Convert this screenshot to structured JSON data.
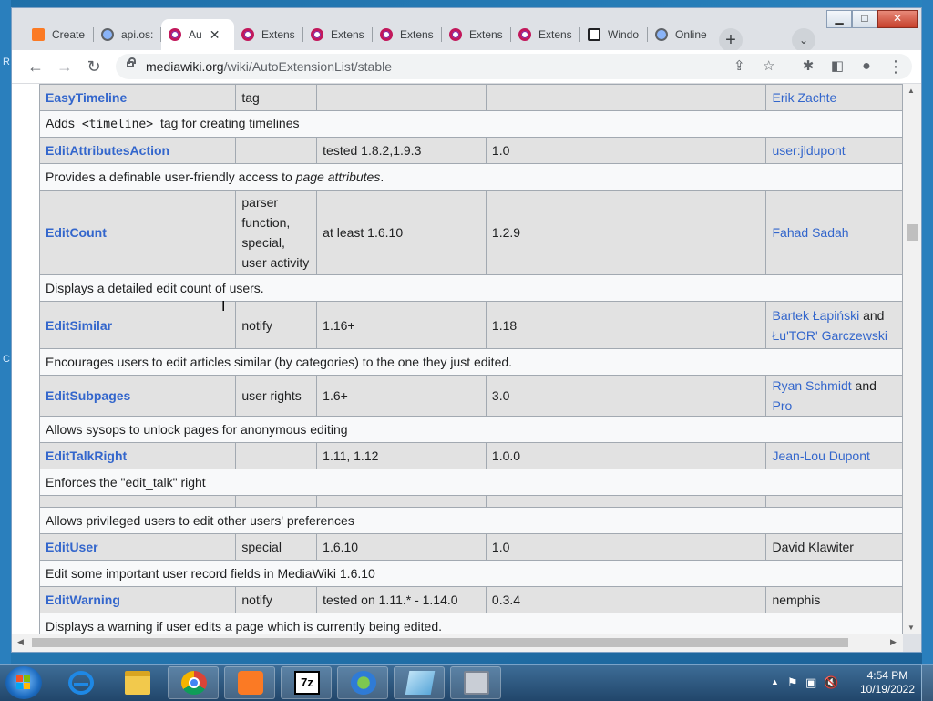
{
  "browser": {
    "tabs": [
      {
        "title": "Create",
        "icon": "xampp-icon",
        "active": false
      },
      {
        "title": "api.os:",
        "icon": "globe-icon",
        "active": false
      },
      {
        "title": "Au",
        "icon": "ring-icon",
        "active": true
      },
      {
        "title": "Extens",
        "icon": "ring-icon",
        "active": false
      },
      {
        "title": "Extens",
        "icon": "ring-icon",
        "active": false
      },
      {
        "title": "Extens",
        "icon": "ring-icon",
        "active": false
      },
      {
        "title": "Extens",
        "icon": "ring-icon",
        "active": false
      },
      {
        "title": "Extens",
        "icon": "ring-icon",
        "active": false
      },
      {
        "title": "Windo",
        "icon": "wiki-icon",
        "active": false
      },
      {
        "title": "Online",
        "icon": "globe-icon",
        "active": false
      }
    ],
    "tab_close": "✕",
    "new_tab": "+",
    "tab_list": "⌄",
    "window_controls": {
      "minimize": "▁",
      "maximize": "□",
      "close": "✕"
    },
    "url_host": "mediawiki.org",
    "url_path": "/wiki/AutoExtensionList/stable",
    "nav": {
      "back": "←",
      "forward": "→",
      "reload": "↻"
    },
    "toolbar_icons": {
      "share": "⇪",
      "star": "☆",
      "extensions": "✱",
      "sidepanel": "◧",
      "profile": "●",
      "menu": "⋮"
    }
  },
  "table": {
    "rows": [
      {
        "kind": "main",
        "name": "EasyTimeline",
        "type": "tag",
        "mw": "",
        "version": "",
        "author": [
          {
            "text": "Erik Zachte",
            "link": true
          }
        ]
      },
      {
        "kind": "desc",
        "pre": "Adds ",
        "code": "<timeline>",
        "post": " tag for creating timelines"
      },
      {
        "kind": "main",
        "name": "EditAttributesAction",
        "type": "",
        "mw": "tested 1.8.2,1.9.3",
        "version": "1.0",
        "author": [
          {
            "text": "user:jldupont",
            "link": true
          }
        ]
      },
      {
        "kind": "desc",
        "pre": "Provides a definable user-friendly access to ",
        "em": "page attributes",
        "post": "."
      },
      {
        "kind": "main",
        "name": "EditCount",
        "type": "parser function, special, user activity",
        "mw": "at least 1.6.10",
        "version": "1.2.9",
        "author": [
          {
            "text": "Fahad Sadah",
            "link": true
          }
        ]
      },
      {
        "kind": "desc",
        "pre": "Displays a detailed edit count of users."
      },
      {
        "kind": "main",
        "name": "EditSimilar",
        "type": "notify",
        "mw": "1.16+",
        "version": "1.18",
        "author": [
          {
            "text": "Bartek Łapiński",
            "link": true
          },
          {
            "text": " and ",
            "link": false
          },
          {
            "text": "Łu",
            "link": true
          },
          {
            "text": "'TOR' Garczewski",
            "link": true
          }
        ]
      },
      {
        "kind": "desc",
        "pre": "Encourages users to edit articles similar (by categories) to the one they just edited."
      },
      {
        "kind": "main",
        "name": "EditSubpages",
        "type": "user rights",
        "mw": "1.6+",
        "version": "3.0",
        "author": [
          {
            "text": "Ryan Schmidt",
            "link": true
          },
          {
            "text": " and ",
            "link": false
          },
          {
            "text": "Pro",
            "link": true
          }
        ]
      },
      {
        "kind": "desc",
        "pre": "Allows sysops to unlock pages for anonymous editing"
      },
      {
        "kind": "main",
        "name": "EditTalkRight",
        "type": "",
        "mw": "1.11, 1.12",
        "version": "1.0.0",
        "author": [
          {
            "text": "Jean-Lou Dupont",
            "link": true
          }
        ]
      },
      {
        "kind": "desc",
        "pre": "Enforces the \"edit_talk\" right"
      },
      {
        "kind": "main",
        "name": "",
        "type": "",
        "mw": "",
        "version": "",
        "author": []
      },
      {
        "kind": "desc",
        "pre": "Allows privileged users to edit other users' preferences"
      },
      {
        "kind": "main",
        "name": "EditUser",
        "type": "special",
        "mw": "1.6.10",
        "version": "1.0",
        "author": [
          {
            "text": "David Klawiter",
            "link": false
          }
        ]
      },
      {
        "kind": "desc",
        "pre": "Edit some important user record fields in MediaWiki 1.6.10"
      },
      {
        "kind": "main",
        "name": "EditWarning",
        "type": "notify",
        "mw": "tested on 1.11.* - 1.14.0",
        "version": "0.3.4",
        "author": [
          {
            "text": "nemphis",
            "link": false
          }
        ]
      },
      {
        "kind": "desc",
        "pre": "Displays a warning if user edits a page which is currently being edited."
      }
    ]
  },
  "taskbar": {
    "apps": [
      "internet-explorer",
      "file-explorer",
      "chrome",
      "xampp",
      "7zip",
      "idm",
      "notepad",
      "archive"
    ],
    "tray_icons": [
      "show-hidden-icons",
      "action-center-flag",
      "network-icon",
      "volume-muted-icon"
    ],
    "tray_glyphs": [
      "▲",
      "⚑",
      "▣",
      "🔇"
    ],
    "time": "4:54 PM",
    "date": "10/19/2022"
  },
  "colors": {
    "link": "#3366cc",
    "row_main": "#e2e2e2",
    "row_desc": "#f8f9fa",
    "taskbar": "#2c5a82"
  }
}
